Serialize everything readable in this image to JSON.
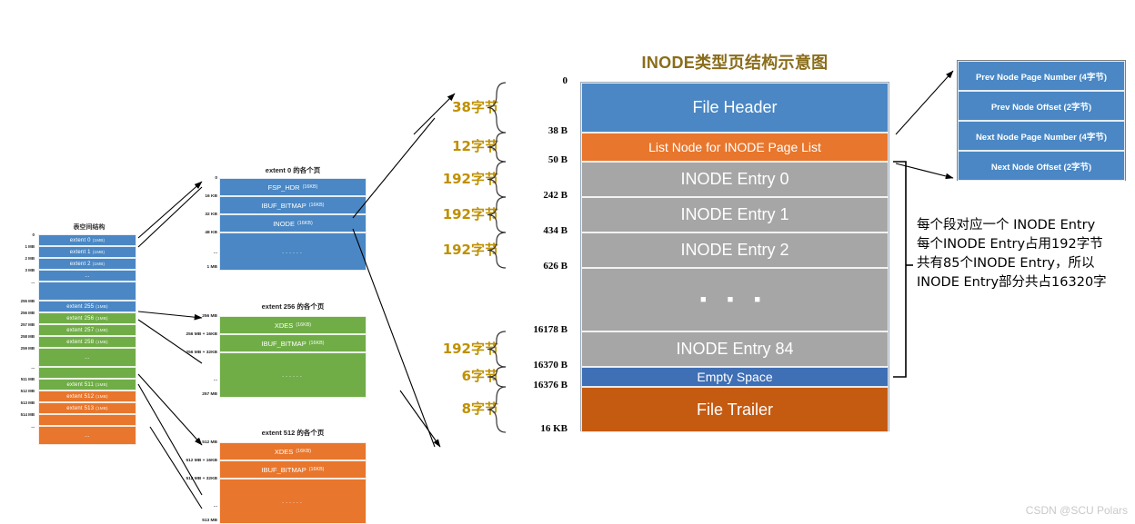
{
  "colors": {
    "blue": "#4A87C4",
    "blue_dark": "#3F6FB5",
    "orange": "#E8762C",
    "orange_dark": "#C55A11",
    "green": "#70AD47",
    "gray": "#A6A6A6",
    "gold": "#BF9000",
    "title_gold": "#8A6D1A",
    "watermark": "#C9C9C9"
  },
  "tablespace": {
    "title": "表空间结构",
    "rows": [
      {
        "label": "extent 0",
        "size": "(1MB)",
        "offset": "0",
        "color": "blue"
      },
      {
        "label": "extent 1",
        "size": "(1MB)",
        "offset": "1 MB",
        "color": "blue"
      },
      {
        "label": "extent 2",
        "size": "(1MB)",
        "offset": "2 MB",
        "color": "blue"
      },
      {
        "label": "...",
        "size": "",
        "offset": "3 MB",
        "color": "blue"
      },
      {
        "label": "",
        "size": "",
        "offset": "...",
        "color": "blue"
      },
      {
        "label": "extent 255",
        "size": "(1MB)",
        "offset": "255 MB",
        "color": "blue"
      },
      {
        "label": "extent 256",
        "size": "(1MB)",
        "offset": "256 MB",
        "color": "green"
      },
      {
        "label": "extent 257",
        "size": "(1MB)",
        "offset": "257 MB",
        "color": "green"
      },
      {
        "label": "extent 258",
        "size": "(1MB)",
        "offset": "258 MB",
        "color": "green"
      },
      {
        "label": "...",
        "size": "",
        "offset": "259 MB",
        "color": "green"
      },
      {
        "label": "",
        "size": "",
        "offset": "...",
        "color": "green"
      },
      {
        "label": "extent 511",
        "size": "(1MB)",
        "offset": "511 MB",
        "color": "green"
      },
      {
        "label": "extent 512",
        "size": "(1MB)",
        "offset": "512 MB",
        "color": "orange"
      },
      {
        "label": "extent 513",
        "size": "(1MB)",
        "offset": "513 MB",
        "color": "orange"
      },
      {
        "label": "",
        "size": "",
        "offset": "514 MB",
        "color": "orange"
      },
      {
        "label": "...",
        "size": "",
        "offset": "...",
        "color": "orange"
      }
    ]
  },
  "extents": [
    {
      "title": "extent 0 的各个页",
      "color": "blue",
      "rows": [
        {
          "label": "FSP_HDR",
          "size": "(16KB)",
          "offset": "0"
        },
        {
          "label": "IBUF_BITMAP",
          "size": "(16KB)",
          "offset": "16 KB"
        },
        {
          "label": "INODE",
          "size": "(16KB)",
          "offset": "32 KB"
        },
        {
          "label": "......",
          "size": "",
          "offset": "48 KB"
        }
      ],
      "offset_mid": "...",
      "offset_end": "1 MB"
    },
    {
      "title": "extent 256 的各个页",
      "color": "green",
      "rows": [
        {
          "label": "XDES",
          "size": "(16KB)",
          "offset": "256 MB"
        },
        {
          "label": "IBUF_BITMAP",
          "size": "(16KB)",
          "offset": "256 MB + 16KB"
        },
        {
          "label": "......",
          "size": "",
          "offset": "256 MB + 32KB"
        }
      ],
      "offset_mid": "...",
      "offset_end": "257 MB"
    },
    {
      "title": "extent 512 的各个页",
      "color": "orange",
      "rows": [
        {
          "label": "XDES",
          "size": "(16KB)",
          "offset": "512 MB"
        },
        {
          "label": "IBUF_BITMAP",
          "size": "(16KB)",
          "offset": "512 MB + 16KB"
        },
        {
          "label": "......",
          "size": "",
          "offset": "512 MB + 32KB"
        }
      ],
      "offset_mid": "...",
      "offset_end": "513 MB"
    }
  ],
  "inode_page": {
    "title": "INODE类型页结构示意图",
    "rows": [
      {
        "label": "File Header",
        "color": "blue",
        "font": 18,
        "offset": "0"
      },
      {
        "label": "List Node for INODE Page List",
        "color": "orange",
        "font": 14,
        "offset": "38 B"
      },
      {
        "label": "INODE Entry 0",
        "color": "gray",
        "font": 18,
        "offset": "50 B"
      },
      {
        "label": "INODE Entry 1",
        "color": "gray",
        "font": 18,
        "offset": "242 B"
      },
      {
        "label": "INODE Entry 2",
        "color": "gray",
        "font": 18,
        "offset": "434 B"
      },
      {
        "label": "■  ■  ■",
        "color": "gray",
        "font": 11,
        "offset": "626 B"
      },
      {
        "label": "INODE Entry 84",
        "color": "gray",
        "font": 18,
        "offset": "16178 B"
      },
      {
        "label": "Empty Space",
        "color": "blue_dark",
        "font": 14,
        "offset": "16370 B"
      },
      {
        "label": "File Trailer",
        "color": "orange_dark",
        "font": 18,
        "offset": "16376 B"
      }
    ],
    "offset_end": "16 KB",
    "size_labels": [
      {
        "text": "38字节"
      },
      {
        "text": "12字节"
      },
      {
        "text": "192字节"
      },
      {
        "text": "192字节"
      },
      {
        "text": "192字节"
      },
      {
        "text": "192字节"
      },
      {
        "text": "6字节"
      },
      {
        "text": "8字节"
      }
    ]
  },
  "node_box": {
    "rows": [
      {
        "label": "Prev Node Page Number (4字节)"
      },
      {
        "label": "Prev Node Offset (2字节)"
      },
      {
        "label": "Next Node Page Number (4字节)"
      },
      {
        "label": "Next Node Offset (2字节)"
      }
    ]
  },
  "note": {
    "lines": [
      "每个段对应一个 INODE Entry",
      "每个INODE Entry占用192字节",
      "共有85个INODE Entry，所以",
      "INODE Entry部分共占16320字"
    ]
  },
  "watermark": "CSDN @SCU Polars"
}
